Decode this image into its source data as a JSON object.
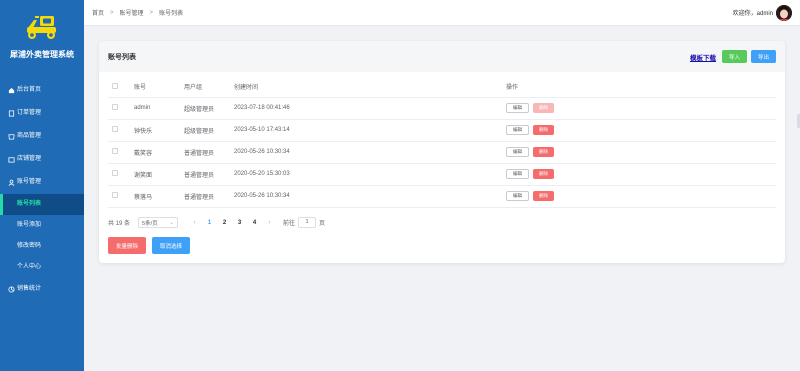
{
  "sidebar": {
    "app_title": "犀浦外卖管理系统",
    "logo_icon": "scooter-icon",
    "items": [
      {
        "label": "后台首页",
        "icon": "home-icon"
      },
      {
        "label": "订单管理",
        "icon": "order-icon"
      },
      {
        "label": "商品管理",
        "icon": "goods-icon"
      },
      {
        "label": "店铺管理",
        "icon": "shop-icon"
      },
      {
        "label": "账号管理",
        "icon": "account-icon"
      },
      {
        "label": "账号列表",
        "active": true
      },
      {
        "label": "账号添加"
      },
      {
        "label": "修改密码"
      },
      {
        "label": "个人中心"
      },
      {
        "label": "销售统计",
        "icon": "stats-icon"
      }
    ]
  },
  "header": {
    "breadcrumb": [
      "首页",
      "账号管理",
      "账号列表"
    ],
    "greeting": "欢迎你，admin"
  },
  "card": {
    "title": "账号列表",
    "template_link": "模板下载",
    "import_label": "导入",
    "export_label": "导出"
  },
  "table": {
    "headers": [
      "账号",
      "用户组",
      "创建时间",
      "操作"
    ],
    "rows": [
      {
        "account": "admin",
        "group": "超级管理员",
        "created": "2023-07-18 00:41:46",
        "edit": "编辑",
        "delete": "删除",
        "delete_disabled": true
      },
      {
        "account": "钟快乐",
        "group": "超级管理员",
        "created": "2023-05-10 17:43:14",
        "edit": "编辑",
        "delete": "删除"
      },
      {
        "account": "戴笑容",
        "group": "普通管理员",
        "created": "2020-05-26 10:30:34",
        "edit": "编辑",
        "delete": "删除"
      },
      {
        "account": "谢笑面",
        "group": "普通管理员",
        "created": "2020-05-20 15:30:03",
        "edit": "编辑",
        "delete": "删除"
      },
      {
        "account": "蔡落马",
        "group": "普通管理员",
        "created": "2020-05-26 10:30:34",
        "edit": "编辑",
        "delete": "删除"
      }
    ]
  },
  "pagination": {
    "total": "共 19 条",
    "page_size": "5条/页",
    "pages": [
      "1",
      "2",
      "3",
      "4"
    ],
    "current": "1",
    "goto_label": "前往",
    "goto_value": "1",
    "page_unit": "页"
  },
  "actions": {
    "batch_delete": "批量删除",
    "cancel_select": "取消选择"
  },
  "colors": {
    "sidebar": "#1f6bb5",
    "active_text": "#22ddaa",
    "primary": "#3fa0f7",
    "success": "#58c95b",
    "danger": "#f56c6c"
  }
}
